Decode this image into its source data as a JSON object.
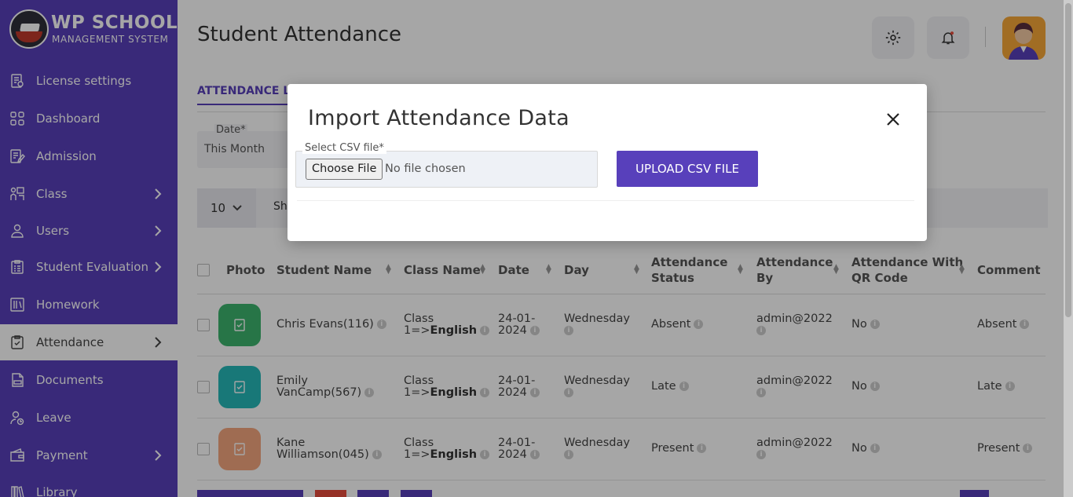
{
  "brand": {
    "title": "WP SCHOOL",
    "subtitle": "MANAGEMENT SYSTEM"
  },
  "sidebar": {
    "items": [
      {
        "label": "License settings",
        "icon": "license-icon",
        "chevron": false
      },
      {
        "label": "Dashboard",
        "icon": "dashboard-icon",
        "chevron": false
      },
      {
        "label": "Admission",
        "icon": "admission-icon",
        "chevron": false
      },
      {
        "label": "Class",
        "icon": "class-icon",
        "chevron": true
      },
      {
        "label": "Users",
        "icon": "users-icon",
        "chevron": true
      },
      {
        "label": "Student Evaluation",
        "icon": "evaluation-icon",
        "chevron": true
      },
      {
        "label": "Homework",
        "icon": "homework-icon",
        "chevron": false
      },
      {
        "label": "Attendance",
        "icon": "attendance-icon",
        "chevron": true,
        "active": true
      },
      {
        "label": "Documents",
        "icon": "documents-icon",
        "chevron": false
      },
      {
        "label": "Leave",
        "icon": "leave-icon",
        "chevron": false
      },
      {
        "label": "Payment",
        "icon": "payment-icon",
        "chevron": true
      },
      {
        "label": "Library",
        "icon": "library-icon",
        "chevron": false
      }
    ]
  },
  "header": {
    "title": "Student Attendance"
  },
  "tabs": {
    "attendance_list": "ATTENDANCE LIST"
  },
  "filter": {
    "date_label": "Date*",
    "date_value": "This Month"
  },
  "toolbar": {
    "page_length": "10",
    "show_label": "Sh"
  },
  "table": {
    "columns": {
      "photo": "Photo",
      "student_name": "Student Name",
      "class_name": "Class Name",
      "date": "Date",
      "day": "Day",
      "status_l1": "Attendance",
      "status_l2": "Status",
      "by_l1": "Attendance",
      "by_l2": "By",
      "qr_l1": "Attendance With",
      "qr_l2": "QR Code",
      "comment": "Comment"
    },
    "rows": [
      {
        "name_l1": "Chris Evans(116)",
        "name_l2": "",
        "class_l1": "Class",
        "class_l2a": "1=>",
        "class_l2b": "English",
        "date_l1": "24-01-",
        "date_l2": "2024",
        "day": "Wednesday",
        "status": "Absent",
        "by": "admin@2022",
        "qr": "No",
        "comment": "Absent",
        "photo_color": "#3cb46e"
      },
      {
        "name_l1": "Emily",
        "name_l2": "VanCamp(567)",
        "class_l1": "Class",
        "class_l2a": "1=>",
        "class_l2b": "English",
        "date_l1": "24-01-",
        "date_l2": "2024",
        "day": "Wednesday",
        "status": "Late",
        "by": "admin@2022",
        "qr": "No",
        "comment": "Late",
        "photo_color": "#26b8b8"
      },
      {
        "name_l1": "Kane",
        "name_l2": "Williamson(045)",
        "class_l1": "Class",
        "class_l2a": "1=>",
        "class_l2b": "English",
        "date_l1": "24-01-",
        "date_l2": "2024",
        "day": "Wednesday",
        "status": "Present",
        "by": "admin@2022",
        "qr": "No",
        "comment": "Present",
        "photo_color": "#f5a77f"
      }
    ]
  },
  "modal": {
    "title": "Import Attendance Data",
    "file_label": "Select CSV file*",
    "choose_button": "Choose File",
    "file_status": "No file chosen",
    "upload_button": "UPLOAD CSV FILE"
  },
  "colors": {
    "brand": "#5840bb",
    "overlay": "rgba(0,0,0,0.35)"
  }
}
